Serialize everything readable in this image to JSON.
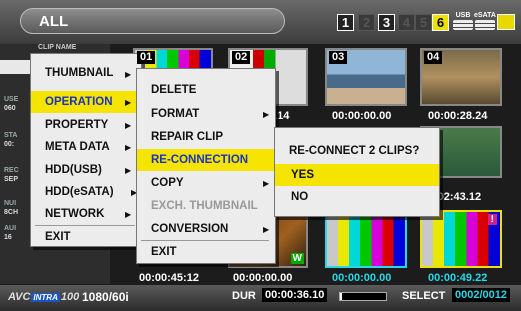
{
  "top_bar": {
    "tab_label": "ALL",
    "slots": [
      {
        "label": "1",
        "state": "on"
      },
      {
        "label": "2",
        "state": "dim"
      },
      {
        "label": "3",
        "state": "on"
      },
      {
        "label": "4",
        "state": "dim"
      },
      {
        "label": "5",
        "state": "dim"
      },
      {
        "label": "6",
        "state": "selected"
      }
    ],
    "device_icons": [
      {
        "label": "USB",
        "icon": "usb-drive-icon"
      },
      {
        "label": "eSATA",
        "icon": "esata-drive-icon"
      },
      {
        "label": "",
        "icon": "card-icon"
      }
    ]
  },
  "left_panel": {
    "header": "CLIP NAME",
    "rows": [
      {
        "label": "USE",
        "value": "060"
      },
      {
        "label": "STA",
        "value": "00:"
      },
      {
        "label": "REC",
        "value": "SEP"
      },
      {
        "label": "NUI",
        "value": "8CH"
      },
      {
        "label": "AUI",
        "value": "16"
      }
    ]
  },
  "thumbnails": [
    {
      "number": "01",
      "timecode": ""
    },
    {
      "number": "02",
      "timecode": ""
    },
    {
      "number": "03",
      "timecode": "00:00:00.00"
    },
    {
      "number": "04",
      "timecode": "00:00:28.24"
    },
    {
      "number": "",
      "timecode": "2.14"
    },
    {
      "number": "",
      "timecode": ":02:43.12"
    },
    {
      "number": "",
      "timecode": "00:00:45:12"
    },
    {
      "number": "",
      "timecode": "00:00:00.00"
    },
    {
      "number": "",
      "timecode": "00:00:00.00"
    },
    {
      "number": "",
      "timecode": "00:00:49.22"
    }
  ],
  "bottom_bar": {
    "logo": "AVC INTRA 100",
    "format": "1080/60i",
    "duration_label": "DUR",
    "duration_value": "00:00:36.10",
    "duration_progress": 0.05,
    "select_label": "SELECT",
    "select_value": "0002/0012"
  },
  "main_menu": {
    "items": [
      "THUMBNAIL",
      "OPERATION",
      "PROPERTY",
      "META DATA",
      "HDD(USB)",
      "HDD(eSATA)",
      "NETWORK",
      "EXIT"
    ],
    "selected": "OPERATION"
  },
  "operation_menu": {
    "items": [
      "DELETE",
      "FORMAT",
      "REPAIR CLIP",
      "RE-CONNECTION",
      "COPY",
      "EXCH. THUMBNAIL",
      "CONVERSION",
      "EXIT"
    ],
    "selected": "RE-CONNECTION",
    "disabled": [
      "EXCH. THUMBNAIL"
    ]
  },
  "confirm_dialog": {
    "question": "RE-CONNECT 2 CLIPS?",
    "options": [
      "YES",
      "NO"
    ],
    "selected": "YES"
  },
  "colors": {
    "highlight": "#f5e400",
    "timecode_cyan": "#27d8e8",
    "menu_bg": "#ececec"
  }
}
